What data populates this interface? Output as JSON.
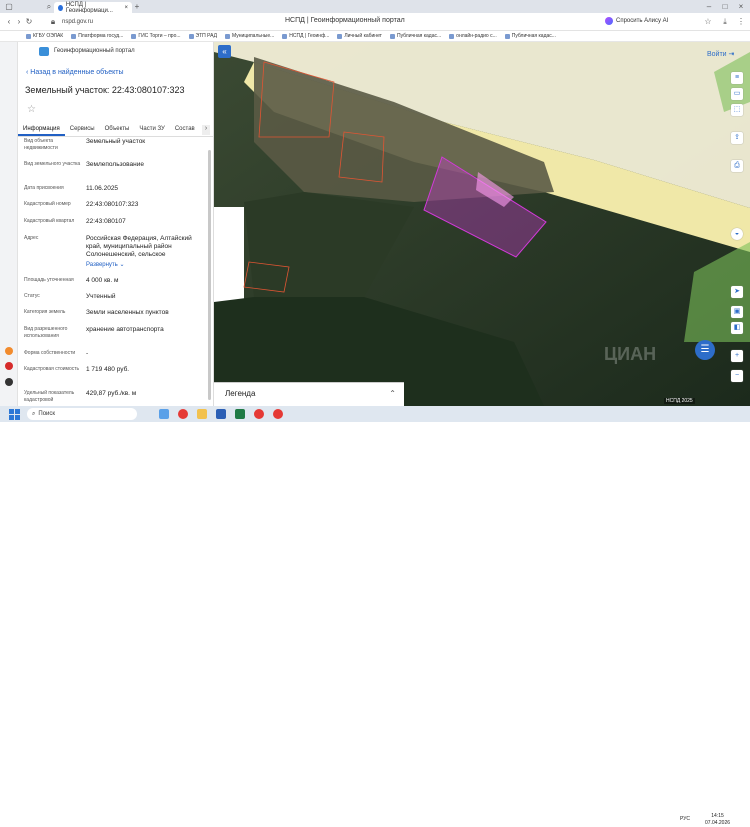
{
  "browser": {
    "tabs": [
      {
        "label": "НСПД | Геоинформаци...",
        "active": true
      }
    ],
    "new_tab": "+",
    "url": "nspd.gov.ru",
    "page_title": "НСПД | Геоинформационный портал",
    "alice_label": "Спросить Алису AI",
    "bookmarks": [
      "КГБУ ОЭЛАК",
      "Платформа госуд...",
      "ГИС Торги – про...",
      "ЭТП РАД",
      "Муниципальные...",
      "НСПД | Геоинф...",
      "Личный кабинет",
      "Публичная кадас...",
      "онлайн-радио с...",
      "Публичная кадас..."
    ]
  },
  "portal": {
    "name": "Геоинформационный портал",
    "back_label": "Назад в найденные объекты",
    "title": "Земельный участок: 22:43:080107:323",
    "tabs": [
      "Информация",
      "Сервисы",
      "Объекты",
      "Части ЗУ",
      "Состав"
    ],
    "properties": [
      {
        "key": "Вид объекта недвижимости",
        "value": "Земельный участок"
      },
      {
        "key": "Вид земельного участка",
        "value": "Землепользование"
      },
      {
        "key": "Дата присвоения",
        "value": "11.06.2025"
      },
      {
        "key": "Кадастровый номер",
        "value": "22:43:080107:323"
      },
      {
        "key": "Кадастровый квартал",
        "value": "22:43:080107"
      },
      {
        "key": "Адрес",
        "value": "Российская Федерация, Алтайский край, муниципальный район Солонешенский, сельское"
      },
      {
        "key": "Площадь уточненная",
        "value": "4 000 кв. м"
      },
      {
        "key": "Статус",
        "value": "Учтенный"
      },
      {
        "key": "Категория земель",
        "value": "Земли населенных пунктов"
      },
      {
        "key": "Вид разрешенного использования",
        "value": "хранение автотранспорта"
      },
      {
        "key": "Форма собственности",
        "value": "-"
      },
      {
        "key": "Кадастровая стоимость",
        "value": "1 719 480 руб."
      },
      {
        "key": "Удельный показатель кадастровой",
        "value": "429,87 руб./кв. м"
      }
    ],
    "expand_label": "Развернуть"
  },
  "map": {
    "login_label": "Войти",
    "legend_label": "Легенда",
    "watermark": "ЦИАН",
    "scale_label": "НСПД 2025"
  },
  "taskbar": {
    "search_placeholder": "Поиск",
    "lang": "РУС",
    "time": "14:15",
    "date": "07.04.2026"
  },
  "colors": {
    "accent": "#2d6dc9",
    "parcel": "#d23ad9",
    "road": "#efe6a6"
  }
}
